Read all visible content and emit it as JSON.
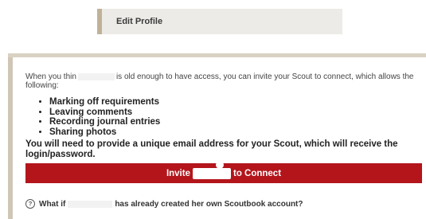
{
  "edit_profile": {
    "label": "Edit Profile"
  },
  "intro": {
    "before": "When you thin",
    "after": "is old enough to have access, you can invite your Scout to connect, which allows the following:"
  },
  "features": [
    "Marking off requirements",
    "Leaving comments",
    "Recording journal entries",
    "Sharing photos"
  ],
  "notice": "You will need to provide a unique email address for your Scout, which will receive the login/password.",
  "invite_button": {
    "before": "Invite",
    "after": "to Connect"
  },
  "faq": {
    "icon": "?",
    "before": "What if",
    "after": "has already created her own Scoutbook account?"
  },
  "colors": {
    "accent": "#b3151b",
    "sidebar_border": "#bfb298"
  }
}
